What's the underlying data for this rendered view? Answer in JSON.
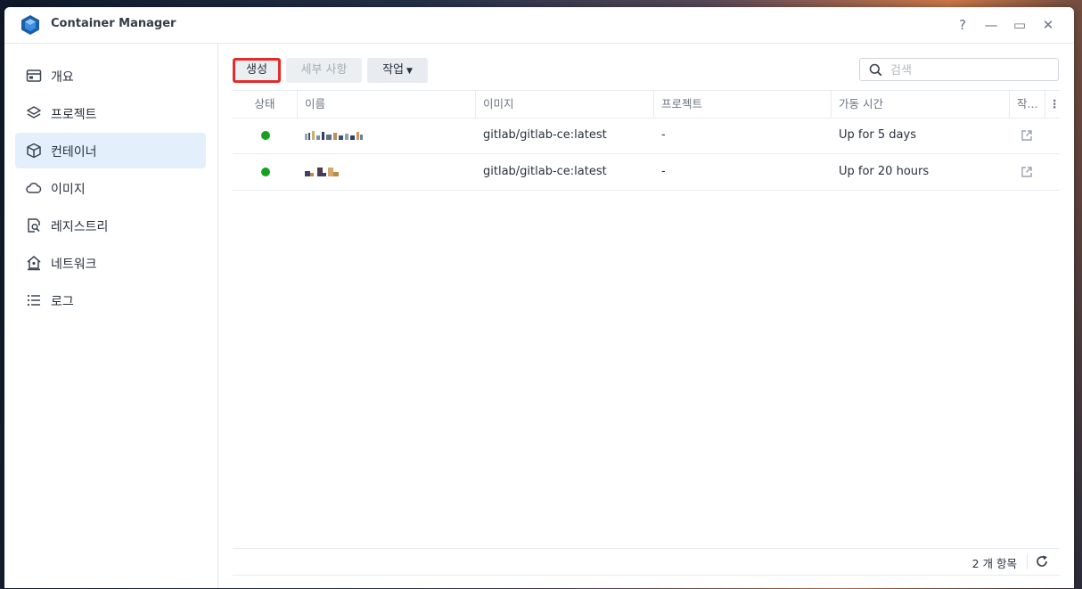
{
  "window": {
    "title": "Container Manager",
    "controls": {
      "help": "?",
      "minimize": "—",
      "maximize": "▭",
      "close": "✕"
    }
  },
  "sidebar": {
    "items": [
      {
        "label": "개요",
        "icon": "overview-icon",
        "active": false
      },
      {
        "label": "프로젝트",
        "icon": "layers-icon",
        "active": false
      },
      {
        "label": "컨테이너",
        "icon": "cube-icon",
        "active": true
      },
      {
        "label": "이미지",
        "icon": "cloud-icon",
        "active": false
      },
      {
        "label": "레지스트리",
        "icon": "registry-search-icon",
        "active": false
      },
      {
        "label": "네트워크",
        "icon": "network-home-icon",
        "active": false
      },
      {
        "label": "로그",
        "icon": "list-icon",
        "active": false
      }
    ]
  },
  "toolbar": {
    "create_label": "생성",
    "details_label": "세부 사항",
    "action_label": "작업"
  },
  "search": {
    "placeholder": "검색"
  },
  "table": {
    "columns": [
      "상태",
      "이름",
      "이미지",
      "프로젝트",
      "가동 시간",
      "작..."
    ],
    "rows": [
      {
        "status": "running",
        "image": "gitlab/gitlab-ce:latest",
        "project": "-",
        "uptime": "Up for 5 days"
      },
      {
        "status": "running",
        "image": "gitlab/gitlab-ce:latest",
        "project": "-",
        "uptime": "Up for 20 hours"
      }
    ]
  },
  "footer": {
    "count_label": "2 개 항목"
  },
  "colors": {
    "accent_highlight": "#e32b2b",
    "status_running": "#15a31e",
    "active_nav": "#e3f0fc"
  }
}
